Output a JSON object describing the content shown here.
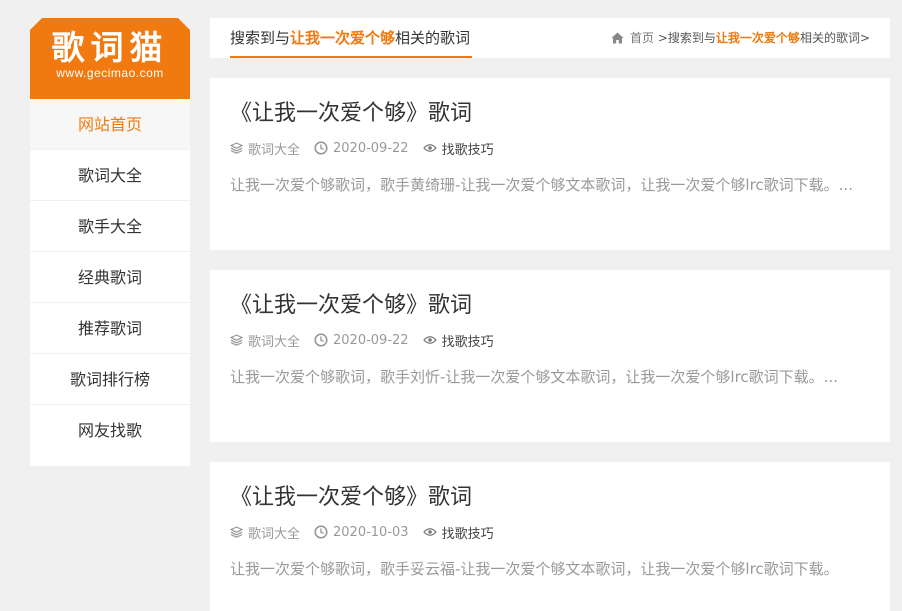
{
  "logo": {
    "title": "歌词猫",
    "url": "www.gecimao.com"
  },
  "nav": [
    {
      "label": "网站首页"
    },
    {
      "label": "歌词大全"
    },
    {
      "label": "歌手大全"
    },
    {
      "label": "经典歌词"
    },
    {
      "label": "推荐歌词"
    },
    {
      "label": "歌词排行榜"
    },
    {
      "label": "网友找歌"
    }
  ],
  "search": {
    "prefix": "搜索到与",
    "keyword": "让我一次爱个够",
    "suffix": "相关的歌词"
  },
  "breadcrumb": {
    "home": "首页",
    "sep": " >",
    "prefix": "搜索到与",
    "keyword": "让我一次爱个够",
    "suffix": "相关的歌词>"
  },
  "results": [
    {
      "title": "《让我一次爱个够》歌词",
      "category": "歌词大全",
      "date": "2020-09-22",
      "tag": "找歌技巧",
      "excerpt": "让我一次爱个够歌词，歌手黄绮珊-让我一次爱个够文本歌词，让我一次爱个够lrc歌词下载。..."
    },
    {
      "title": "《让我一次爱个够》歌词",
      "category": "歌词大全",
      "date": "2020-09-22",
      "tag": "找歌技巧",
      "excerpt": "让我一次爱个够歌词，歌手刘忻-让我一次爱个够文本歌词，让我一次爱个够lrc歌词下载。..."
    },
    {
      "title": "《让我一次爱个够》歌词",
      "category": "歌词大全",
      "date": "2020-10-03",
      "tag": "找歌技巧",
      "excerpt": "让我一次爱个够歌词，歌手妥云福-让我一次爱个够文本歌词，让我一次爱个够lrc歌词下载。"
    }
  ],
  "colors": {
    "accent": "#f07a10",
    "background": "#f0f0f0",
    "muted": "#999999"
  },
  "icons": {
    "home": "home-icon",
    "category": "layers-icon",
    "date": "clock-icon",
    "tag": "eye-icon"
  }
}
